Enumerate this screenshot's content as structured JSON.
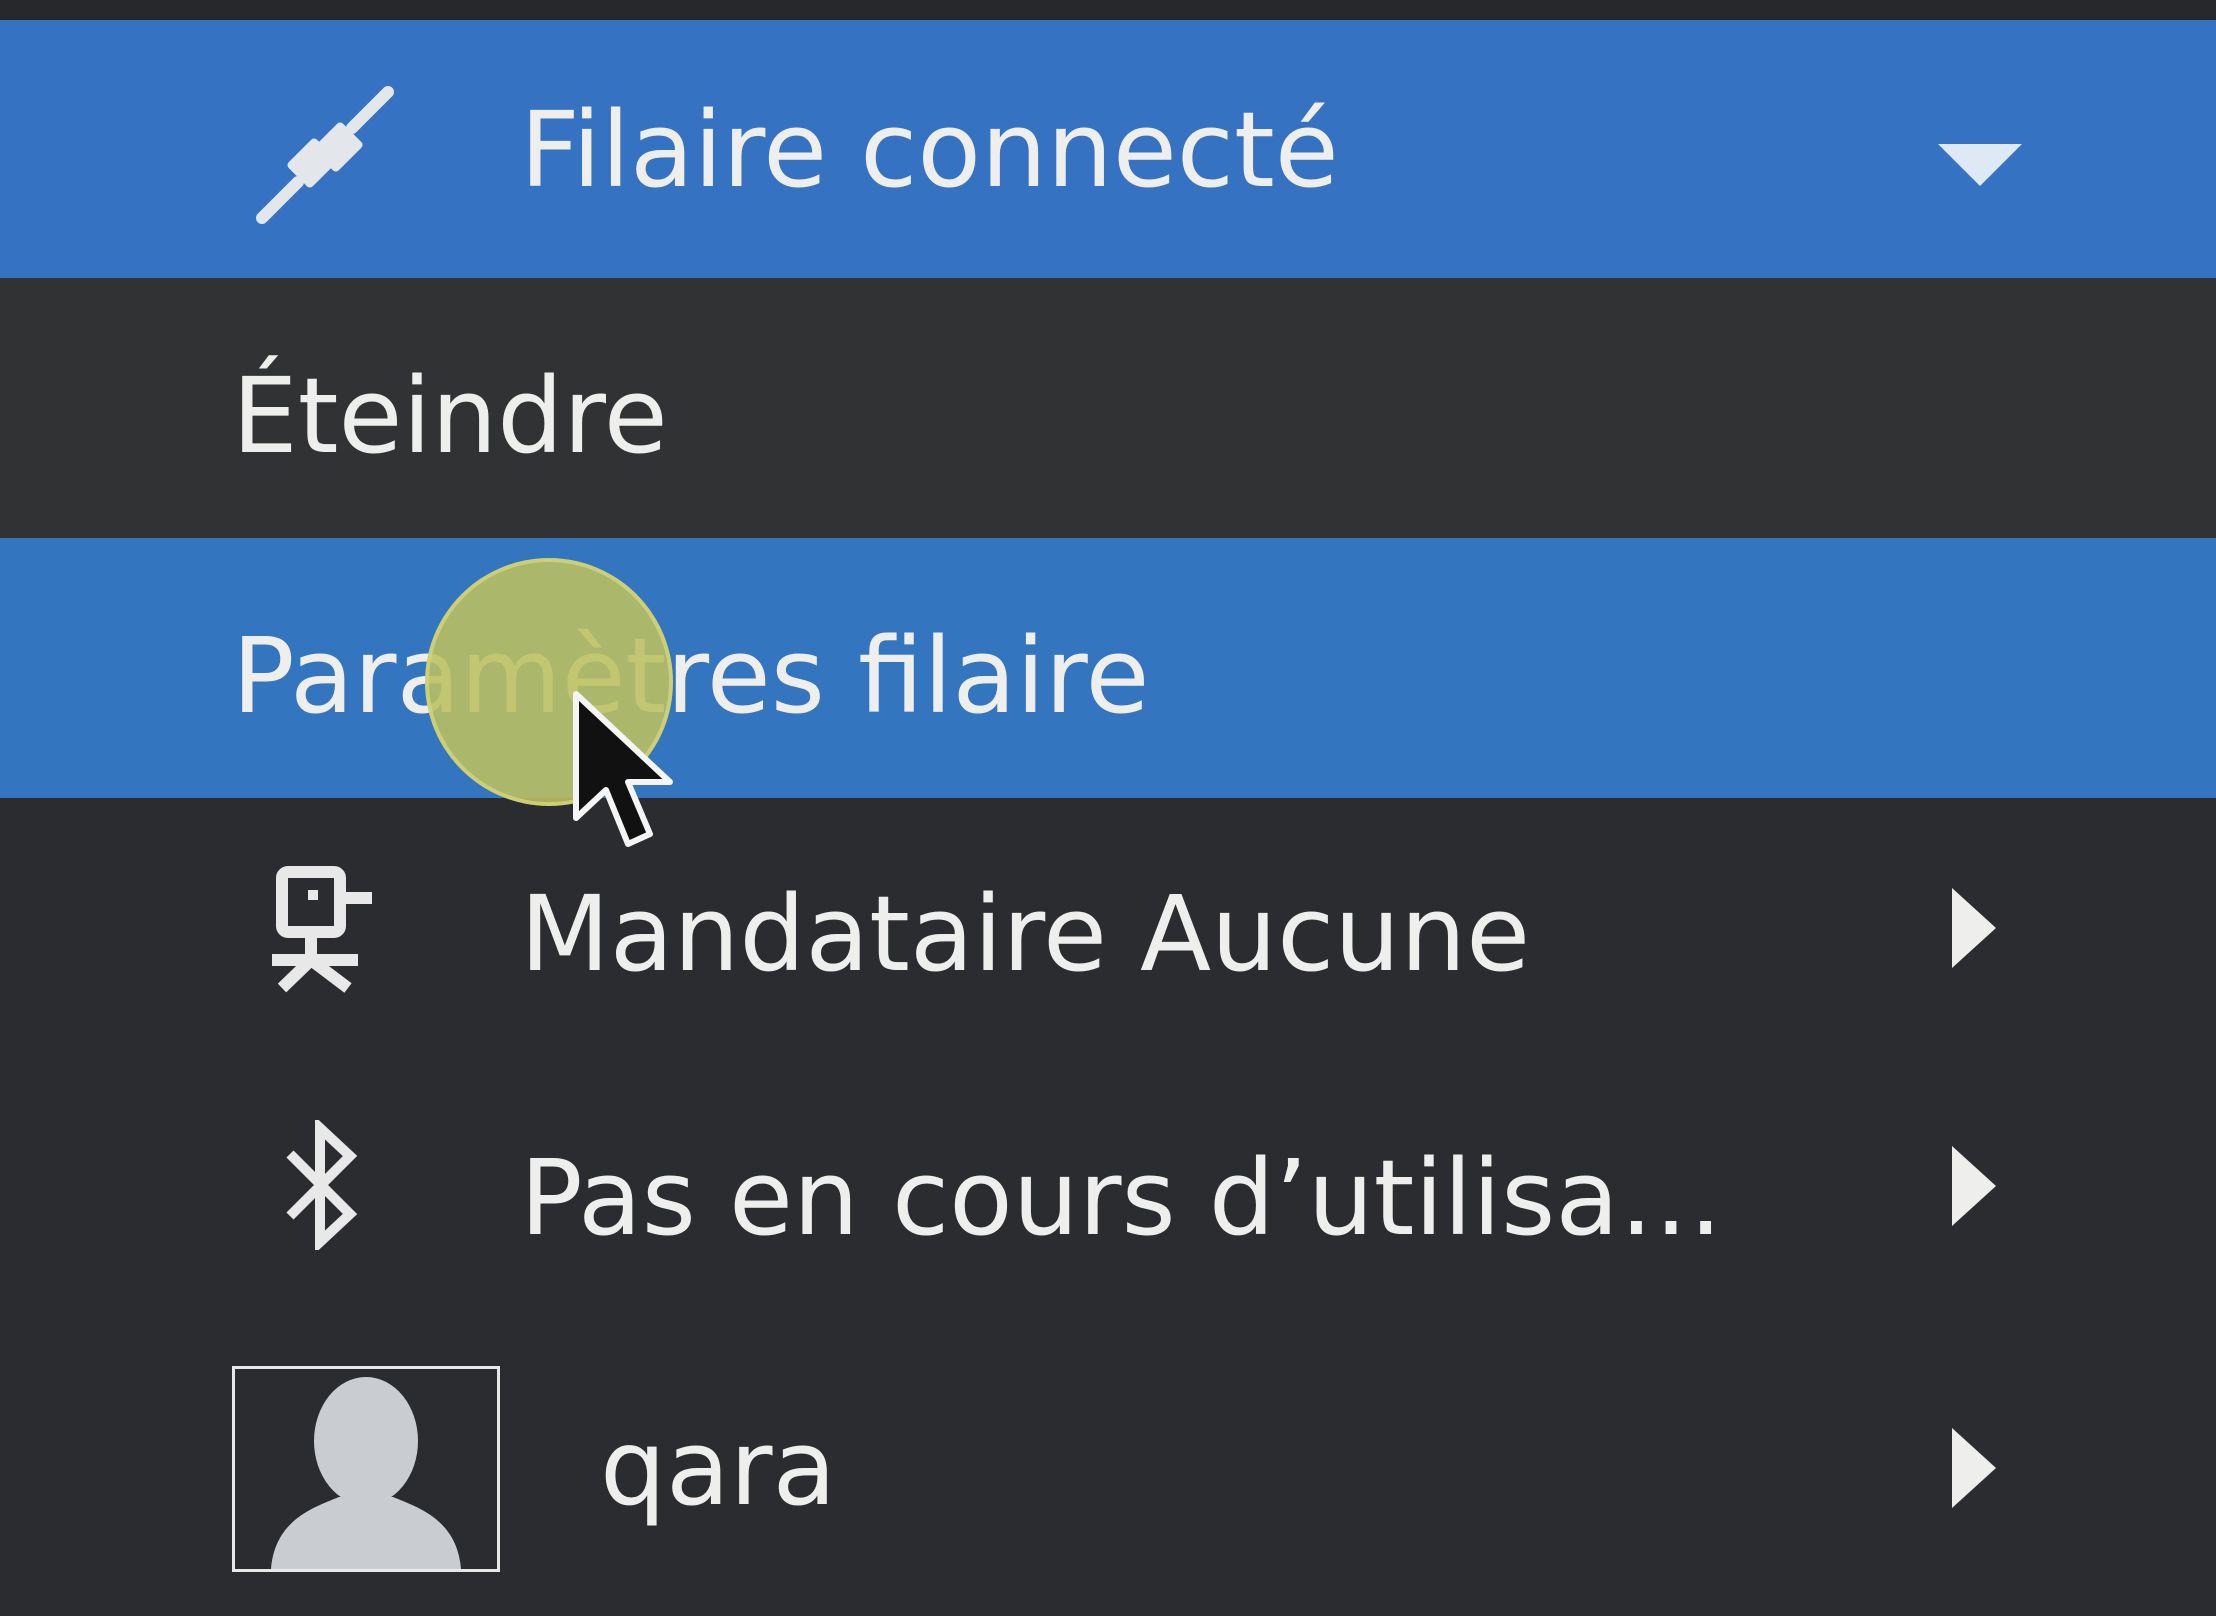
{
  "menu": {
    "wired": {
      "label": "Filaire connecté",
      "icon": "wired-plug-icon",
      "expander": "chevron-down-icon"
    },
    "turn_off": {
      "label": "Éteindre"
    },
    "wired_settings": {
      "label": "Paramètres filaire"
    },
    "proxy": {
      "label": "Mandataire Aucune",
      "icon": "proxy-icon",
      "expander": "chevron-right-icon"
    },
    "bluetooth": {
      "label": "Pas en cours d’utilisa…",
      "icon": "bluetooth-icon",
      "expander": "chevron-right-icon"
    },
    "user": {
      "label": "qara",
      "icon": "avatar-icon",
      "expander": "chevron-right-icon"
    }
  },
  "colors": {
    "menu_background": "#2b2c2f",
    "highlight": "#3375bf",
    "header_highlight": "#3572c1",
    "text": "#eeeeec",
    "click_indicator": "#bcc060"
  }
}
